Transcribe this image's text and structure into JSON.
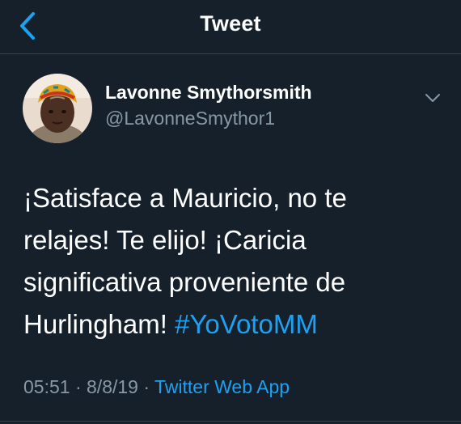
{
  "header": {
    "title": "Tweet",
    "back_icon": "chevron-left-icon"
  },
  "tweet": {
    "author": {
      "name": "Lavonne Smythorsmith",
      "handle": "@LavonneSmythor1",
      "avatar_icon": "profile-photo"
    },
    "caret_icon": "chevron-down-icon",
    "text_lines": [
      "¡Satisface a Mauricio, no te",
      "relajes! Te elijo! ¡Caricia",
      "significativa proveniente de",
      "Hurlingham! "
    ],
    "hashtag": "#YoVotoMM",
    "time": "05:51",
    "separator": " · ",
    "date": "8/8/19",
    "source": "Twitter Web App"
  },
  "colors": {
    "background": "#15202b",
    "accent": "#1da1f2",
    "secondary_text": "#8899a6",
    "border": "#38444d"
  }
}
